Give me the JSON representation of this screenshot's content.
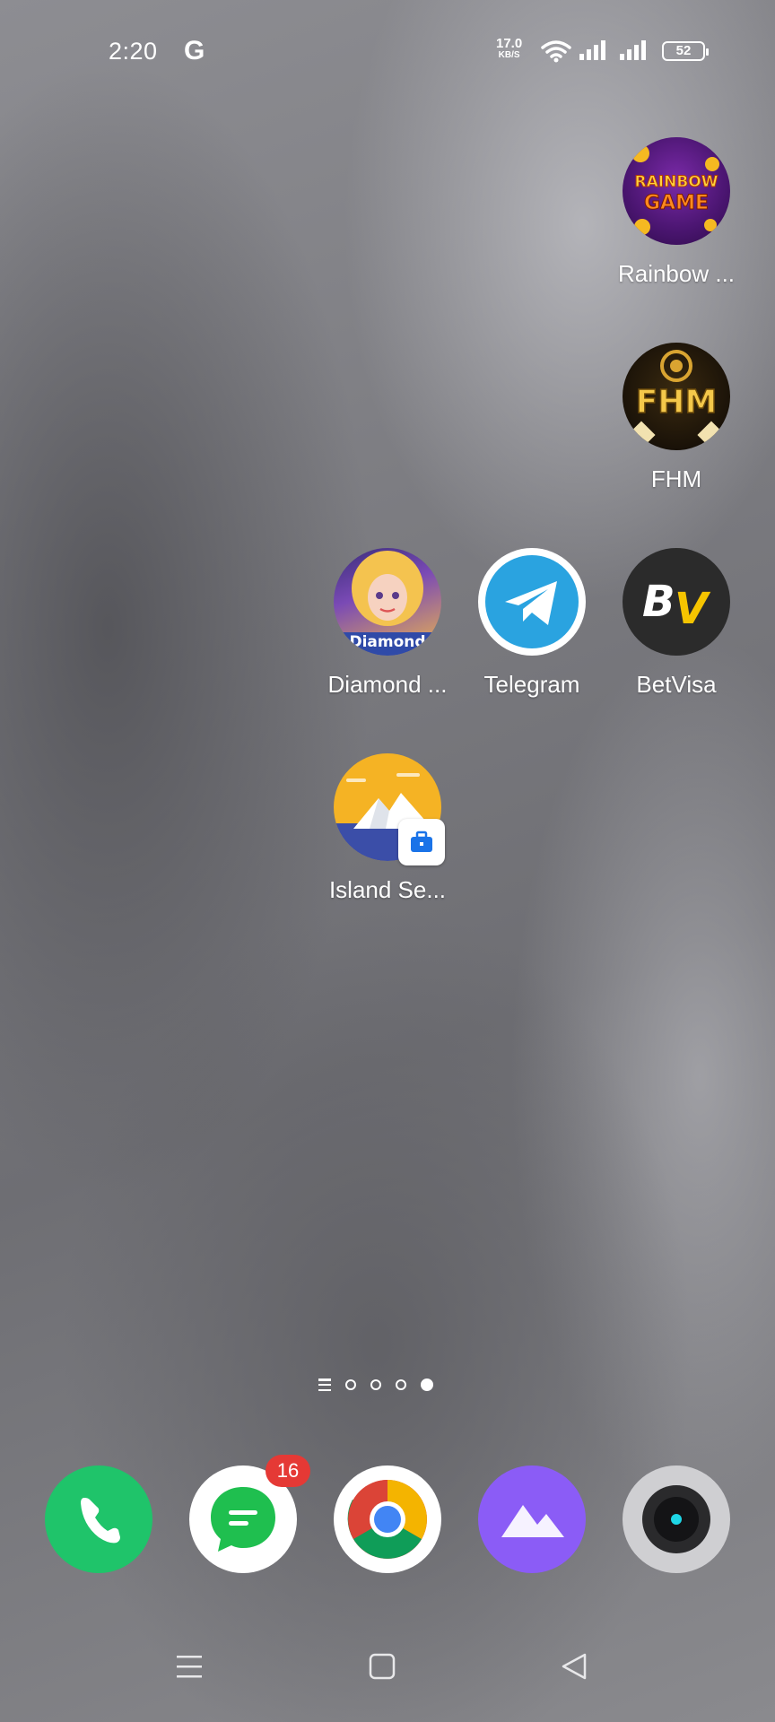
{
  "status_bar": {
    "time": "2:20",
    "google_icon": "G",
    "net_speed_value": "17.0",
    "net_speed_unit": "KB/S",
    "battery": "52",
    "icons": [
      "google-icon",
      "wifi-icon",
      "signal-icon",
      "signal-icon",
      "battery-icon"
    ]
  },
  "home_apps": [
    {
      "label": "Rainbow ...",
      "icon_text": "RAINBOW GAME"
    },
    {
      "label": "FHM",
      "icon_text": "FHM"
    },
    {
      "label": "Diamond ...",
      "icon_text": "Diamond"
    },
    {
      "label": "Telegram",
      "icon_text": ""
    },
    {
      "label": "BetVisa",
      "icon_text": "BV"
    },
    {
      "label": "Island Se...",
      "icon_text": ""
    }
  ],
  "page_indicator": {
    "pages": 4,
    "current": 4
  },
  "dock": {
    "apps": [
      "phone",
      "messages",
      "chrome",
      "gallery",
      "camera"
    ],
    "messages_badge": "16"
  },
  "nav_bar": {
    "icons": [
      "menu-icon",
      "home-icon",
      "back-icon"
    ]
  },
  "colors": {
    "phone": "#1fc46a",
    "messages_bg": "#ffffff",
    "messages_green": "#1fbf4f",
    "gallery": "#8b5cf6",
    "telegram": "#2aa3e0",
    "badge": "#e53935"
  }
}
